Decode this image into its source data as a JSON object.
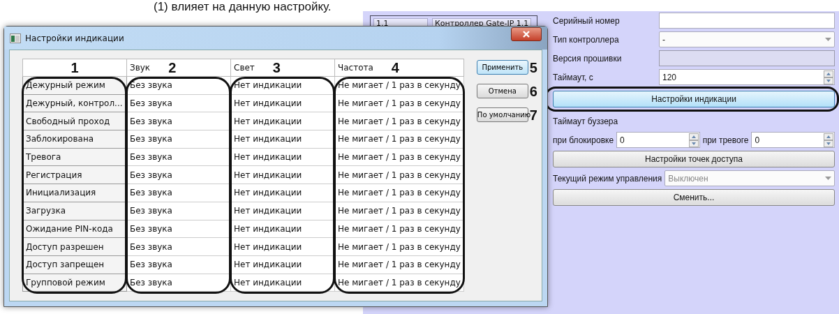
{
  "caption": "(1) влияет на данную настройку.",
  "background_window": {
    "list": {
      "number": "1.1",
      "name": "Контроллер Gate-IP 1.1"
    },
    "form": {
      "serial": {
        "label": "Серийный номер"
      },
      "controller_type": {
        "label": "Тип контроллера",
        "value": "-"
      },
      "firmware": {
        "label": "Версия прошивки"
      },
      "timeout": {
        "label": "Таймаут, с",
        "value": "120"
      },
      "indication_button": {
        "label": "Настройки индикации",
        "highlighted": true
      },
      "buzzer_timeout": {
        "label": "Таймаут буззера"
      },
      "on_block": {
        "label": "при блокировке",
        "value": "0"
      },
      "on_alarm": {
        "label": "при тревоге",
        "value": "0"
      },
      "access_points_button": {
        "label": "Настройки точек доступа"
      },
      "mode": {
        "label": "Текущий режим управления",
        "value": "Выключен",
        "disabled": true
      },
      "change_button": {
        "label": "Сменить..."
      }
    }
  },
  "dialog": {
    "title": "Настройки индикации",
    "columns": [
      {
        "marker": "1"
      },
      {
        "label": "Звук",
        "marker": "2"
      },
      {
        "label": "Свет",
        "marker": "3"
      },
      {
        "label": "Частота",
        "marker": "4"
      }
    ],
    "rows": [
      [
        "Дежурный режим",
        "Без звука",
        "Нет индикации",
        "Не мигает / 1 раз в секунду"
      ],
      [
        "Дежурный, контрол...",
        "Без звука",
        "Нет индикации",
        "Не мигает / 1 раз в секунду"
      ],
      [
        "Свободный проход",
        "Без звука",
        "Нет индикации",
        "Не мигает / 1 раз в секунду"
      ],
      [
        "Заблокирована",
        "Без звука",
        "Нет индикации",
        "Не мигает / 1 раз в секунду"
      ],
      [
        "Тревога",
        "Без звука",
        "Нет индикации",
        "Не мигает / 1 раз в секунду"
      ],
      [
        "Регистрация",
        "Без звука",
        "Нет индикации",
        "Не мигает / 1 раз в секунду"
      ],
      [
        "Инициализация",
        "Без звука",
        "Нет индикации",
        "Не мигает / 1 раз в секунду"
      ],
      [
        "Загрузка",
        "Без звука",
        "Нет индикации",
        "Не мигает / 1 раз в секунду"
      ],
      [
        "Ожидание PIN-кода",
        "Без звука",
        "Нет индикации",
        "Не мигает / 1 раз в секунду"
      ],
      [
        "Доступ разрешен",
        "Без звука",
        "Нет индикации",
        "Не мигает / 1 раз в секунду"
      ],
      [
        "Доступ запрещен",
        "Без звука",
        "Нет индикации",
        "Не мигает / 1 раз в секунду"
      ],
      [
        "Групповой режим",
        "Без звука",
        "Нет индикации",
        "Не мигает / 1 раз в секунду"
      ]
    ],
    "buttons": [
      {
        "label": "Применить",
        "marker": "5",
        "selected": true
      },
      {
        "label": "Отмена",
        "marker": "6",
        "selected": false
      },
      {
        "label": "По умолчанию",
        "marker": "7",
        "selected": false
      }
    ]
  }
}
